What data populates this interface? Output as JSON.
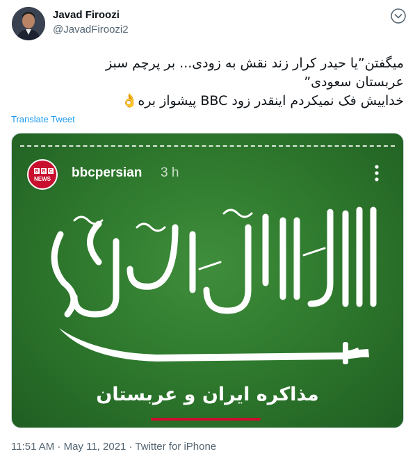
{
  "author": {
    "name": "Javad Firoozi",
    "handle": "@JavadFiroozi2"
  },
  "tweet": {
    "lines": [
      "میگفتن”یا حیدر کرار زند نقش به زودی... بر پرچم سبز",
      "عربستان سعودی”",
      "خداییش فک نمیکردم اینقدر زود BBC پیشواز بره👌"
    ],
    "translate_label": "Translate Tweet"
  },
  "media": {
    "logo_letters": [
      "B",
      "B",
      "C"
    ],
    "logo_sub": "NEWS",
    "username": "bbcpersian",
    "time": "3 h",
    "caption": "مذاکره ایران و عربستان",
    "colors": {
      "flag_green": "#2f7a2e",
      "bbc_red": "#c8102e"
    }
  },
  "footer": {
    "timestamp": "11:51 AM · May 11, 2021 · Twitter for iPhone"
  },
  "colors": {
    "link": "#1d9bf0",
    "secondary_text": "#536471"
  }
}
